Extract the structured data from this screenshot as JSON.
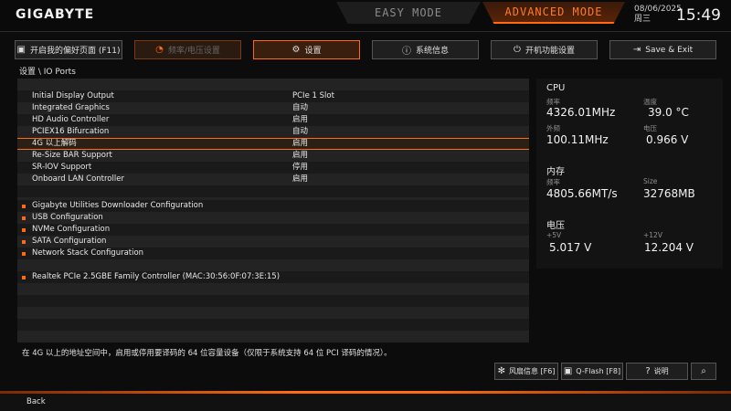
{
  "brand": "GIGABYTE",
  "modes": {
    "easy": "EASY MODE",
    "advanced": "ADVANCED MODE"
  },
  "datetime": {
    "date": "08/06/2025",
    "weekday": "周三",
    "time": "15:49"
  },
  "nav": [
    {
      "label": "开启我的偏好页面 (F11)",
      "icon": "favorite-icon"
    },
    {
      "label": "频率/电压设置",
      "icon": "gauge-icon"
    },
    {
      "label": "设置",
      "icon": "gear-icon"
    },
    {
      "label": "系统信息",
      "icon": "info-icon"
    },
    {
      "label": "开机功能设置",
      "icon": "power-icon"
    },
    {
      "label": "Save & Exit",
      "icon": "exit-icon"
    }
  ],
  "breadcrumb": "设置 \\ IO Ports",
  "rows": [
    {
      "label": "Initial Display Output",
      "value": "PCIe 1 Slot"
    },
    {
      "label": "Integrated Graphics",
      "value": "自动"
    },
    {
      "label": "HD Audio Controller",
      "value": "启用"
    },
    {
      "label": "PCIEX16 Bifurcation",
      "value": "自动"
    },
    {
      "label": "4G 以上解码",
      "value": "启用"
    },
    {
      "label": "Re-Size BAR Support",
      "value": "启用"
    },
    {
      "label": "SR-IOV Support",
      "value": "停用"
    },
    {
      "label": "Onboard LAN Controller",
      "value": "启用"
    }
  ],
  "submenus": [
    "Gigabyte Utilities Downloader Configuration",
    "USB Configuration",
    "NVMe Configuration",
    "SATA Configuration",
    "Network Stack Configuration"
  ],
  "lan_device": "Realtek PCIe 2.5GBE Family Controller (MAC:30:56:0F:07:3E:15)",
  "description": "在 4G 以上的地址空间中，启用或停用要译码的 64 位容量设备（仅限于系统支持 64 位 PCI 译码的情况）。",
  "info": {
    "cpu": {
      "title": "CPU",
      "freq_label": "频率",
      "freq": "4326.01MHz",
      "temp_label": "温度",
      "temp": "39.0 °C",
      "ext_label": "外频",
      "ext": "100.11MHz",
      "volt_label": "电压",
      "volt": "0.966 V"
    },
    "memory": {
      "title": "内存",
      "freq_label": "频率",
      "freq": "4805.66MT/s",
      "size_label": "Size",
      "size": "32768MB"
    },
    "voltage": {
      "title": "电压",
      "v5_label": "+5V",
      "v5": "5.017 V",
      "v12_label": "+12V",
      "v12": "12.204 V"
    }
  },
  "bottom_buttons": [
    {
      "label": "风扇信息 [F6]",
      "icon": "fan-icon"
    },
    {
      "label": "Q-Flash [F8]",
      "icon": "flash-icon"
    },
    {
      "label": "说明",
      "icon": "help-icon"
    },
    {
      "label": "",
      "icon": "search-icon"
    }
  ],
  "footer": {
    "back": "Back"
  },
  "colors": {
    "accent": "#ff6a13",
    "background": "#0c0c0c"
  }
}
